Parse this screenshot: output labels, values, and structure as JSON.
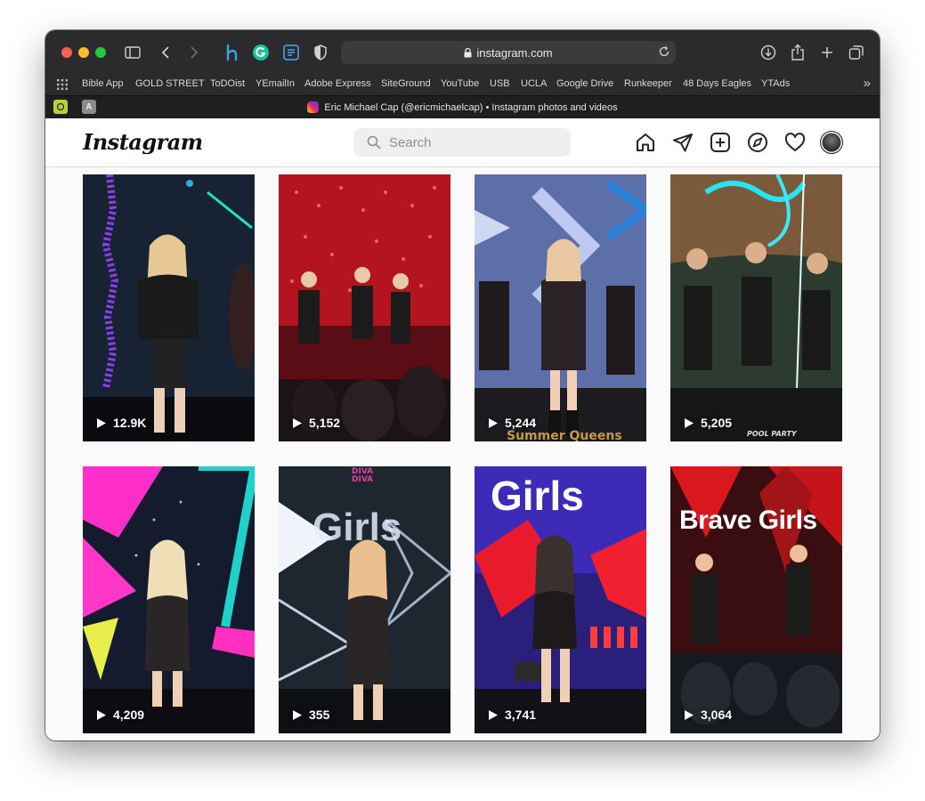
{
  "browser": {
    "address": "instagram.com",
    "bookmarks": [
      "Bible App",
      "GOLD STREET",
      "ToDOist",
      "YEmailIn",
      "Adobe Express",
      "SiteGround",
      "YouTube",
      "USB",
      "UCLA",
      "Google Drive",
      "Runkeeper",
      "48 Days Eagles",
      "YTAds"
    ],
    "pinned_tab_letter": "A",
    "tab_title": "Eric Michael Cap (@ericmichaelcap) • Instagram photos and videos"
  },
  "instagram": {
    "logo": "Instagram",
    "search_placeholder": "Search",
    "nav_icons": [
      "home-icon",
      "direct-icon",
      "new-post-icon",
      "explore-icon",
      "activity-icon",
      "profile-avatar"
    ]
  },
  "posts": [
    {
      "views": "12.9K",
      "overlay": ""
    },
    {
      "views": "5,152",
      "overlay": ""
    },
    {
      "views": "5,244",
      "overlay": "Summer Queens"
    },
    {
      "views": "5,205",
      "overlay": "POOL PARTY"
    },
    {
      "views": "4,209",
      "overlay": ""
    },
    {
      "views": "355",
      "overlay": "DIVA DIVA"
    },
    {
      "views": "3,741",
      "overlay": "Girls"
    },
    {
      "views": "3,064",
      "overlay": "Brave Girls"
    }
  ],
  "post_overlay_big": {
    "p5": "Girls"
  },
  "colors": {
    "toolbar": "#2b2b2d",
    "ig_border": "#dbdbdb",
    "ig_bg": "#fafafa"
  }
}
